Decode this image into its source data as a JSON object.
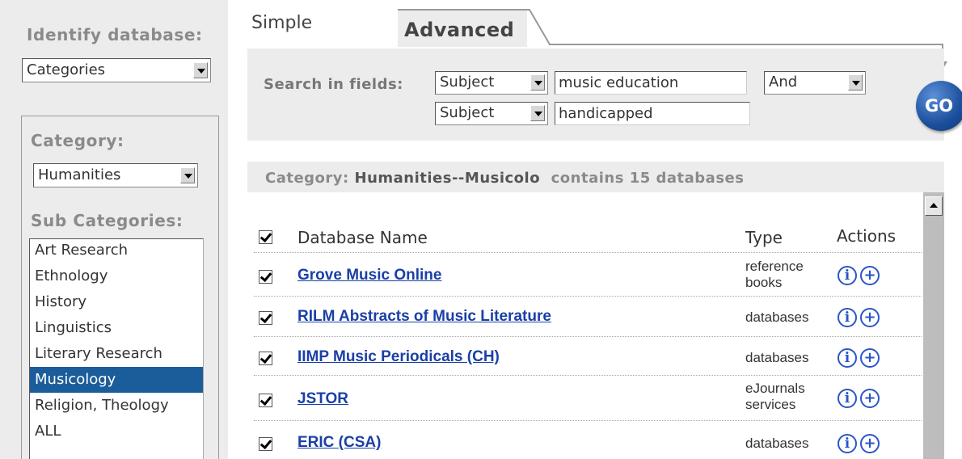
{
  "left_panel": {
    "identify_label": "Identify database:",
    "database_select": "Categories",
    "category_label": "Category:",
    "category_select": "Humanities",
    "subcategories_label": "Sub Categories:",
    "subcategories": [
      {
        "label": "Art Research",
        "selected": false
      },
      {
        "label": "Ethnology",
        "selected": false
      },
      {
        "label": "History",
        "selected": false
      },
      {
        "label": "Linguistics",
        "selected": false
      },
      {
        "label": "Literary Research",
        "selected": false
      },
      {
        "label": "Musicology",
        "selected": true
      },
      {
        "label": "Religion, Theology",
        "selected": false
      },
      {
        "label": "ALL",
        "selected": false
      }
    ]
  },
  "tabs": {
    "simple": "Simple",
    "advanced": "Advanced"
  },
  "search": {
    "label": "Search in fields:",
    "field1": "Subject",
    "term1": "music education",
    "operator1": "And",
    "field2": "Subject",
    "term2": "handicapped",
    "go_label": "GO"
  },
  "results": {
    "prefix": "Category: ",
    "category": "Humanities--Musicolo",
    "suffix": "  contains 15 databases",
    "col_name": "Database Name",
    "col_type": "Type",
    "col_actions": "Actions",
    "info_glyph": "i",
    "add_glyph": "+",
    "rows": [
      {
        "name": "Grove Music Online",
        "type_line1": "reference",
        "type_line2": "books"
      },
      {
        "name": "RILM Abstracts of Music Literature",
        "type_line1": "databases",
        "type_line2": ""
      },
      {
        "name": "IIMP Music Periodicals (CH)",
        "type_line1": "databases",
        "type_line2": ""
      },
      {
        "name": "JSTOR",
        "type_line1": "eJournals",
        "type_line2": "services"
      },
      {
        "name": "ERIC (CSA)",
        "type_line1": "databases",
        "type_line2": ""
      }
    ]
  },
  "colors": {
    "panel_bg": "#ececec",
    "link": "#1a3fa6",
    "selected": "#1b5c9a",
    "icon_blue": "#2a55c8"
  }
}
